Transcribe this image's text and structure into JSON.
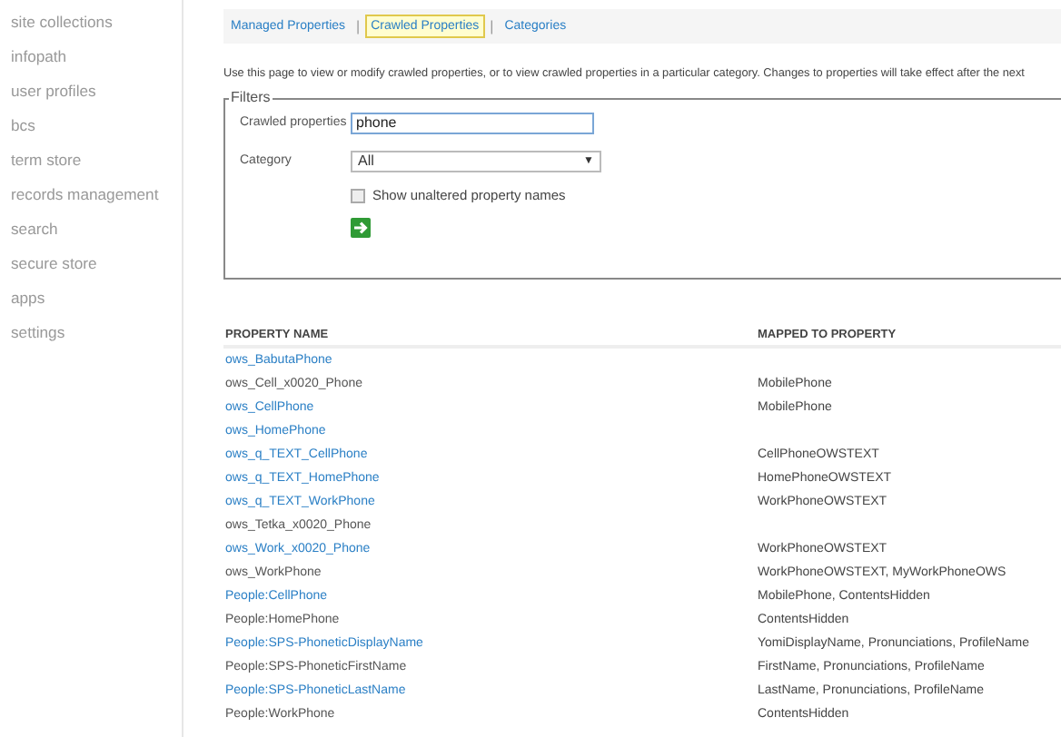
{
  "sidebar": {
    "items": [
      {
        "label": "site collections"
      },
      {
        "label": "infopath"
      },
      {
        "label": "user profiles"
      },
      {
        "label": "bcs"
      },
      {
        "label": "term store"
      },
      {
        "label": "records management"
      },
      {
        "label": "search"
      },
      {
        "label": "secure store"
      },
      {
        "label": "apps"
      },
      {
        "label": "settings"
      }
    ]
  },
  "tabs": [
    {
      "label": "Managed Properties",
      "selected": false
    },
    {
      "label": "Crawled Properties",
      "selected": true
    },
    {
      "label": "Categories",
      "selected": false
    }
  ],
  "separators": [
    "|",
    "|"
  ],
  "description": "Use this page to view or modify crawled properties, or to view crawled properties in a particular category. Changes to properties will take effect after the next",
  "filters": {
    "legend": "Filters",
    "crawled_label": "Crawled properties",
    "crawled_value": "phone",
    "category_label": "Category",
    "category_value": "All",
    "category_caret": "▼",
    "unaltered_label": "Show unaltered property names",
    "unaltered_checked": false
  },
  "table": {
    "columns": [
      "PROPERTY NAME",
      "MAPPED TO PROPERTY"
    ],
    "rows": [
      {
        "name": "ows_BabutaPhone",
        "visited": false,
        "mapped": ""
      },
      {
        "name": "ows_Cell_x0020_Phone",
        "visited": true,
        "mapped": "MobilePhone"
      },
      {
        "name": "ows_CellPhone",
        "visited": false,
        "mapped": "MobilePhone"
      },
      {
        "name": "ows_HomePhone",
        "visited": false,
        "mapped": ""
      },
      {
        "name": "ows_q_TEXT_CellPhone",
        "visited": false,
        "mapped": "CellPhoneOWSTEXT"
      },
      {
        "name": "ows_q_TEXT_HomePhone",
        "visited": false,
        "mapped": "HomePhoneOWSTEXT"
      },
      {
        "name": "ows_q_TEXT_WorkPhone",
        "visited": false,
        "mapped": "WorkPhoneOWSTEXT"
      },
      {
        "name": "ows_Tetka_x0020_Phone",
        "visited": true,
        "mapped": ""
      },
      {
        "name": "ows_Work_x0020_Phone",
        "visited": false,
        "mapped": "WorkPhoneOWSTEXT"
      },
      {
        "name": "ows_WorkPhone",
        "visited": true,
        "mapped": "WorkPhoneOWSTEXT, MyWorkPhoneOWS"
      },
      {
        "name": "People:CellPhone",
        "visited": false,
        "mapped": "MobilePhone, ContentsHidden"
      },
      {
        "name": "People:HomePhone",
        "visited": true,
        "mapped": "ContentsHidden"
      },
      {
        "name": "People:SPS-PhoneticDisplayName",
        "visited": false,
        "mapped": "YomiDisplayName, Pronunciations, ProfileName"
      },
      {
        "name": "People:SPS-PhoneticFirstName",
        "visited": true,
        "mapped": "FirstName, Pronunciations, ProfileName"
      },
      {
        "name": "People:SPS-PhoneticLastName",
        "visited": false,
        "mapped": "LastName, Pronunciations, ProfileName"
      },
      {
        "name": "People:WorkPhone",
        "visited": true,
        "mapped": "ContentsHidden"
      }
    ]
  }
}
